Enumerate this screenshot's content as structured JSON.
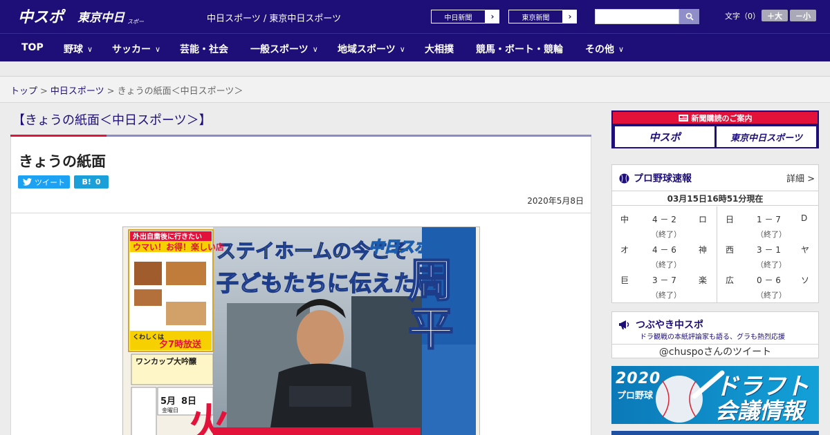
{
  "header": {
    "site_label": "中日スポーツ / 東京中日スポーツ",
    "paper_links": [
      {
        "label": "中日新聞"
      },
      {
        "label": "東京新聞"
      }
    ],
    "font_size_label": "文字（0）",
    "font_increase": "＋大",
    "font_decrease": "－小"
  },
  "nav": [
    {
      "label": "TOP",
      "has_menu": false
    },
    {
      "label": "野球",
      "has_menu": true
    },
    {
      "label": "サッカー",
      "has_menu": true
    },
    {
      "label": "芸能・社会",
      "has_menu": false
    },
    {
      "label": "一般スポーツ",
      "has_menu": true
    },
    {
      "label": "地域スポーツ",
      "has_menu": true
    },
    {
      "label": "大相撲",
      "has_menu": false
    },
    {
      "label": "競馬・ボート・競輪",
      "has_menu": false
    },
    {
      "label": "その他",
      "has_menu": true
    }
  ],
  "breadcrumb": {
    "home": "トップ",
    "section": "中日スポーツ",
    "current": "きょうの紙面＜中日スポーツ＞"
  },
  "page_heading": "【きょうの紙面＜中日スポーツ＞】",
  "article": {
    "title": "きょうの紙面",
    "tweet_label": "ツイート",
    "hatena_label": "B!",
    "hatena_count": "0",
    "date": "2020年5月8日"
  },
  "front_page": {
    "headline_1": "ステイホームの今こそ",
    "headline_2": "子どもたちに伝えたい",
    "masthead": "中日スポーツ",
    "big_name": "周平",
    "side_top": "外出自粛後に行きたい",
    "side_top2": "ウマい！お得！楽しい店",
    "side_promo": "くわしくは",
    "side_time": "夕7時放送",
    "cup_label": "ワンカップ大吟醸",
    "date_month": "5月",
    "date_day": "8日",
    "date_weekday": "金曜日",
    "big_red": "火"
  },
  "sidebar": {
    "subscribe_title": "新聞購読のご案内",
    "subscribe_left": "中スポ",
    "subscribe_right": "東京中日スポーツ",
    "scores_title": "プロ野球速報",
    "scores_detail": "詳細 >",
    "scores_timestamp": "03月15日16時51分現在",
    "games_left": [
      {
        "team1": "中",
        "score": "4 － 2",
        "team2": "ロ",
        "status": "（終了）"
      },
      {
        "team1": "オ",
        "score": "4 － 6",
        "team2": "神",
        "status": "（終了）"
      },
      {
        "team1": "巨",
        "score": "3 － 7",
        "team2": "楽",
        "status": "（終了）"
      }
    ],
    "games_right": [
      {
        "team1": "日",
        "score": "1 － 7",
        "team2": "D",
        "status": "（終了）"
      },
      {
        "team1": "西",
        "score": "3 － 1",
        "team2": "ヤ",
        "status": "（終了）"
      },
      {
        "team1": "広",
        "score": "0 － 6",
        "team2": "ソ",
        "status": "（終了）"
      }
    ],
    "tsubuyaki_title": "つぶやき中スポ",
    "tsubuyaki_sub": "ドラ観戦の本紙評論家も語る、グラも熱烈応援",
    "tsubuyaki_link": "@chuspoさんのツイート",
    "draft_year": "2020",
    "draft_sub": "プロ野球",
    "draft_title": "ドラフト",
    "draft_title2": "会議情報"
  },
  "colors": {
    "brand_navy": "#1e0f78",
    "accent_red": "#e3123a",
    "twitter_blue": "#1da1f2"
  }
}
